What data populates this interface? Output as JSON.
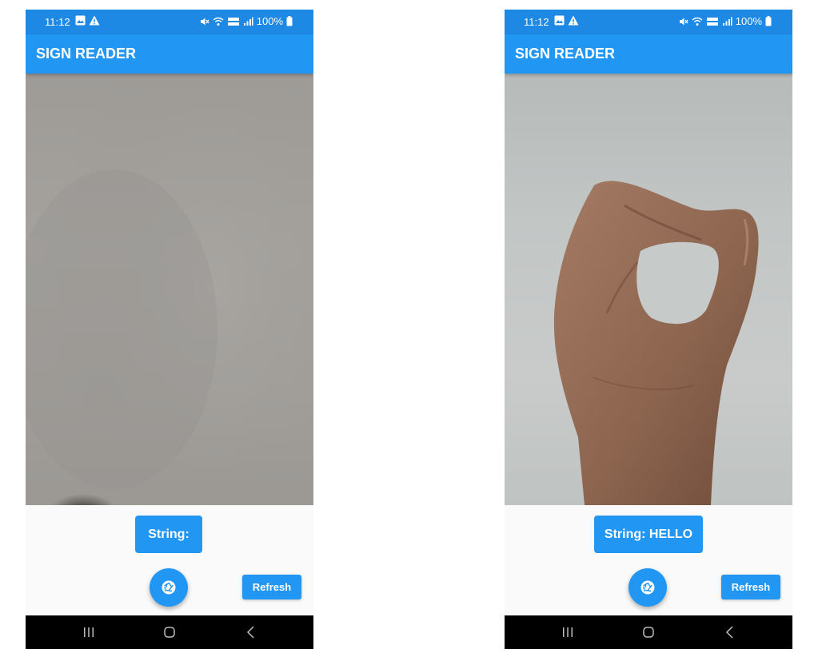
{
  "screens": [
    {
      "status": {
        "time": "11:12",
        "battery": "100%"
      },
      "app_title": "SIGN READER",
      "string_label": "String:",
      "refresh_label": "Refresh"
    },
    {
      "status": {
        "time": "11:12",
        "battery": "100%"
      },
      "app_title": "SIGN READER",
      "string_label": "String: HELLO",
      "refresh_label": "Refresh"
    }
  ],
  "icons": {
    "status_left": [
      "gallery-icon",
      "warning-icon"
    ],
    "status_right": [
      "mute-icon",
      "wifi-icon",
      "volte-icon",
      "signal-icon",
      "battery-icon"
    ],
    "fab": "camera-shutter-icon",
    "nav": [
      "recent-apps-icon",
      "home-icon",
      "back-icon"
    ]
  },
  "colors": {
    "primary": "#2196f3",
    "status_bar": "#1e88e5",
    "nav_bar": "#000000",
    "background": "#fafafa"
  }
}
